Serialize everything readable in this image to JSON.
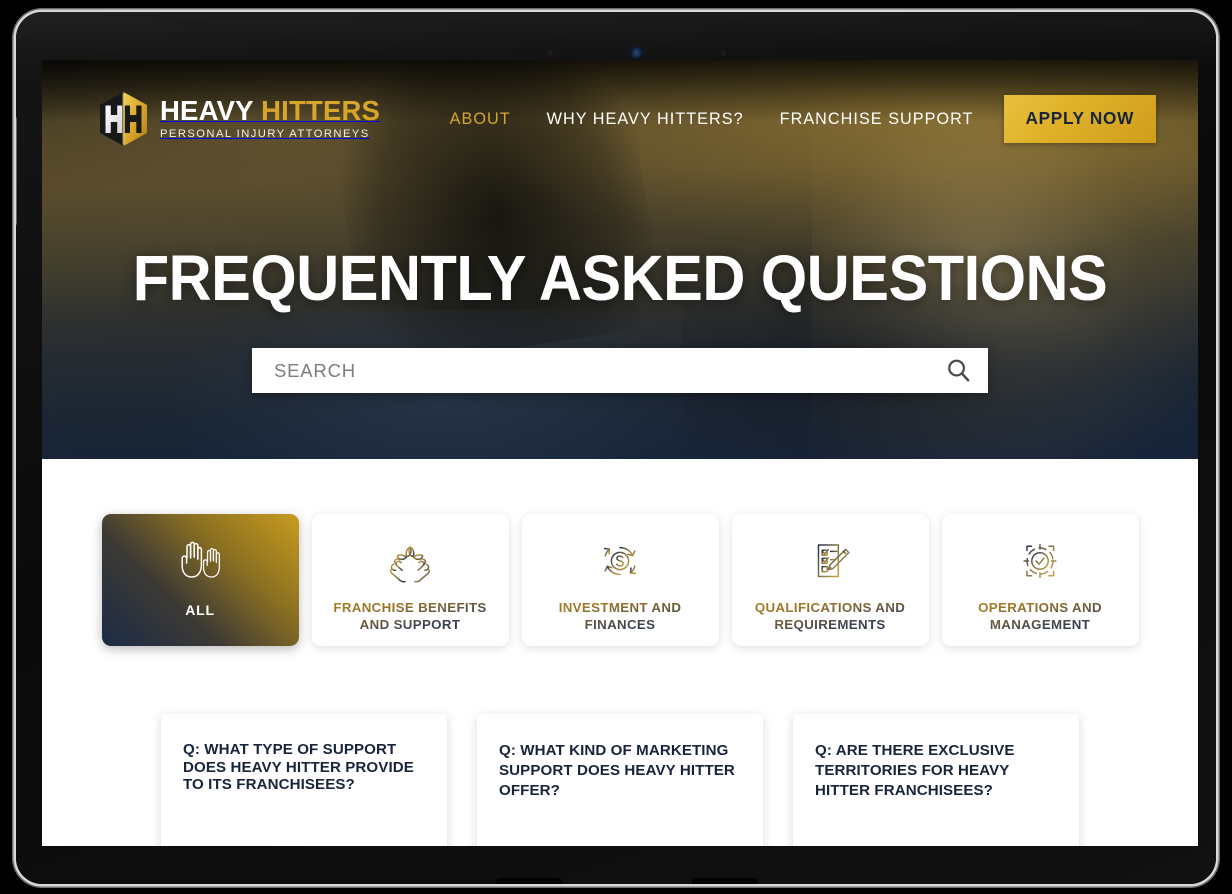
{
  "brand": {
    "logo_icon": "heavy-hitters-shield-logo",
    "name_part1": "HEAVY ",
    "name_part2": "HITTERS",
    "tagline": "PERSONAL INJURY ATTORNEYS",
    "gold": "#d7a52a",
    "navy": "#17243b"
  },
  "nav": {
    "links": [
      {
        "label": "ABOUT",
        "active": true
      },
      {
        "label": "WHY HEAVY HITTERS?",
        "active": false
      },
      {
        "label": "FRANCHISE SUPPORT",
        "active": false
      }
    ],
    "cta_label": "APPLY NOW"
  },
  "hero": {
    "title": "FREQUENTLY ASKED QUESTIONS",
    "search": {
      "value": "",
      "placeholder": "SEARCH",
      "icon": "search-icon"
    }
  },
  "categories": [
    {
      "label": "ALL",
      "icon": "raised-hands-icon",
      "active": true
    },
    {
      "label": "FRANCHISE BENEFITS AND SUPPORT",
      "icon": "hands-plant-icon",
      "active": false
    },
    {
      "label": "INVESTMENT AND FINANCES",
      "icon": "dollar-cycle-icon",
      "active": false
    },
    {
      "label": "QUALIFICATIONS AND REQUIREMENTS",
      "icon": "checklist-pencil-icon",
      "active": false
    },
    {
      "label": "OPERATIONS AND MANAGEMENT",
      "icon": "target-check-icon",
      "active": false
    }
  ],
  "faqs": [
    {
      "question": "Q: WHAT TYPE OF SUPPORT DOES HEAVY HITTER PROVIDE TO ITS FRANCHISEES?",
      "tight": true
    },
    {
      "question": "Q: WHAT KIND OF MARKETING SUPPORT DOES HEAVY HITTER OFFER?",
      "tight": false
    },
    {
      "question": "Q: ARE THERE EXCLUSIVE TERRITORIES FOR HEAVY HITTER FRANCHISEES?",
      "tight": false
    }
  ],
  "device": {
    "camera_icon": "webcam-icon",
    "sensor_icon": "sensor-dot-icon"
  }
}
